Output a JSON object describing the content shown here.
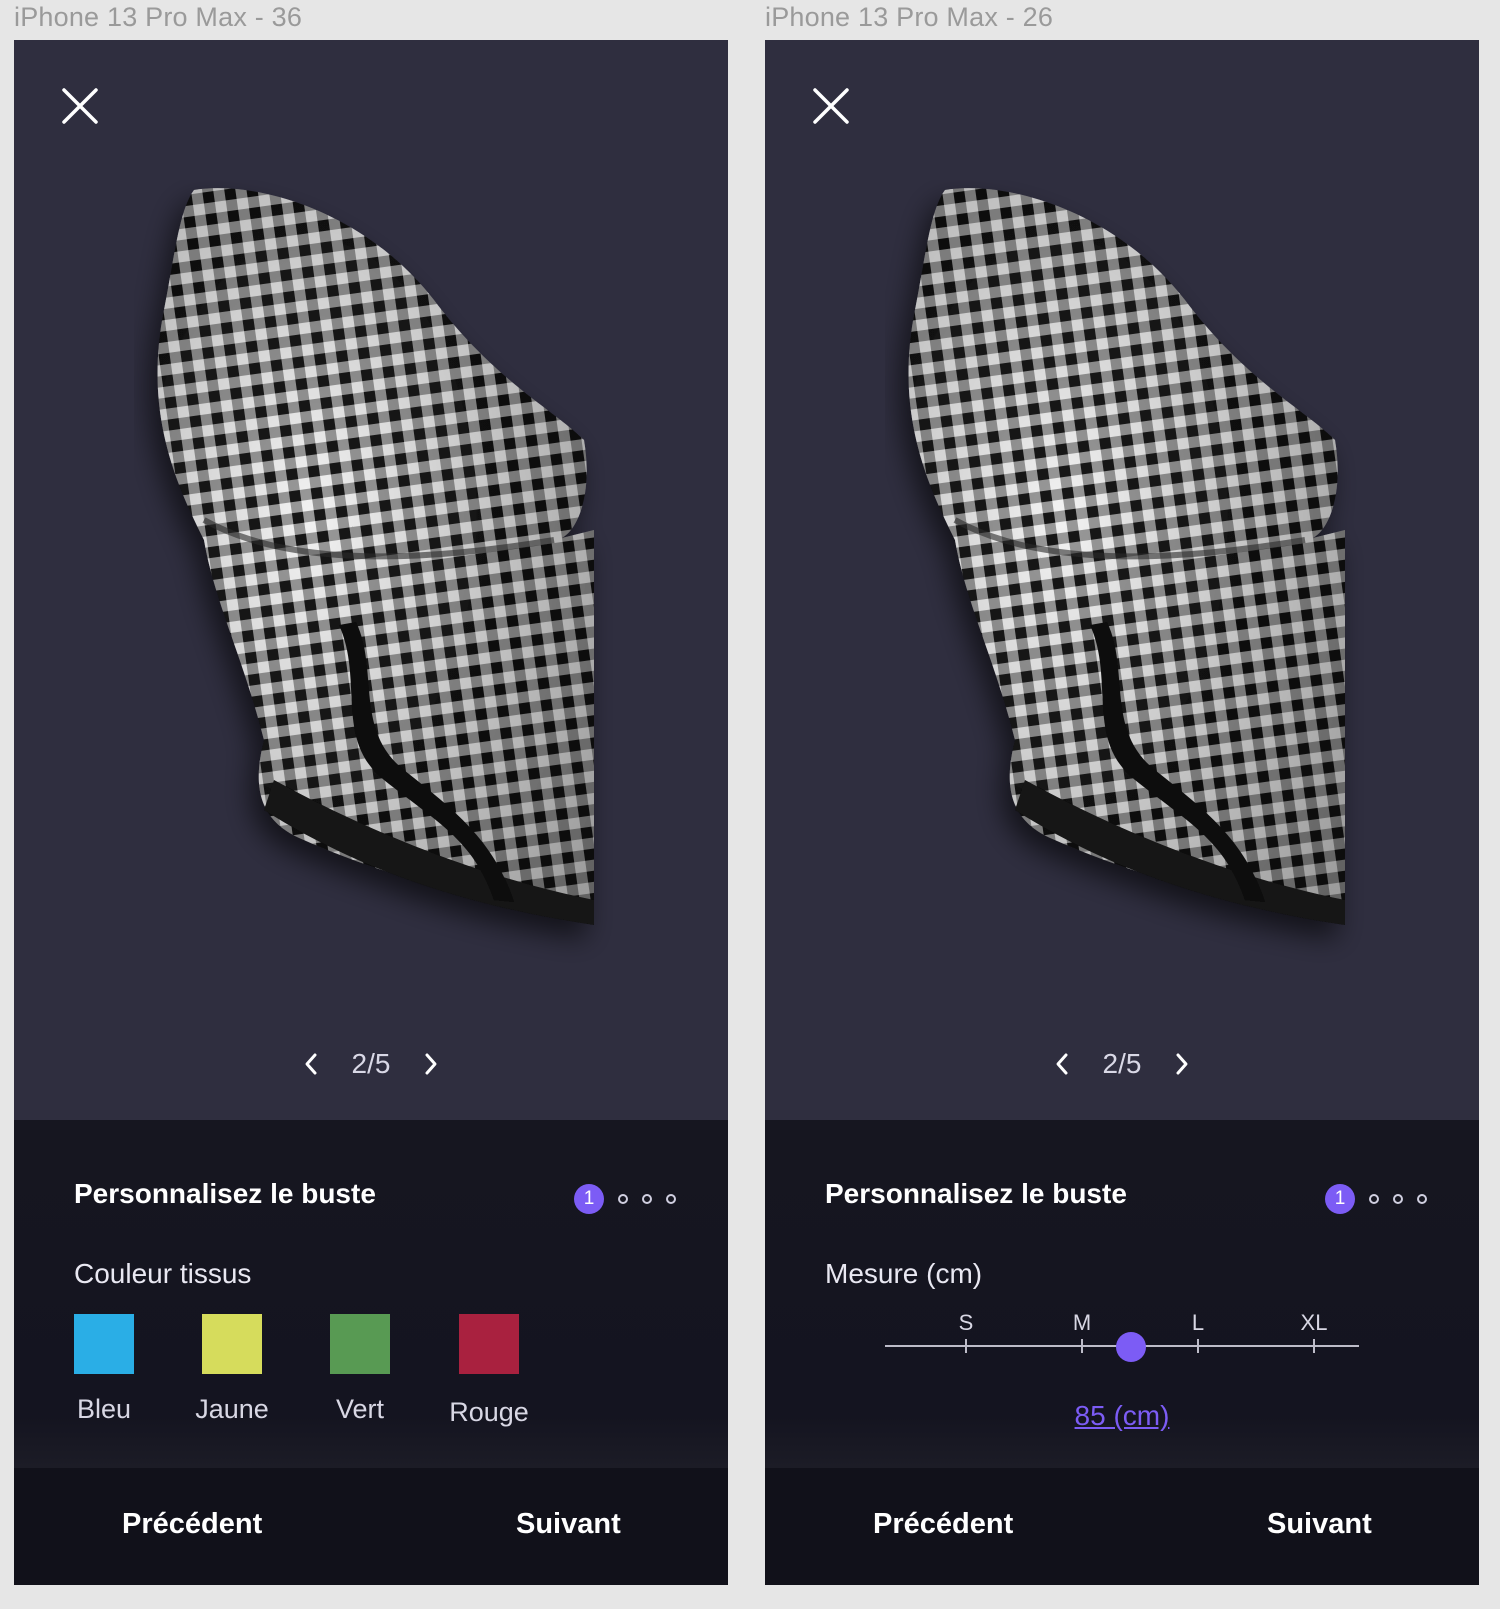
{
  "frames": [
    {
      "title": "iPhone 13 Pro Max - 36",
      "pager": {
        "current": "2/5"
      },
      "panel": {
        "title": "Personnalisez le buste",
        "step_active": "1",
        "section_label": "Couleur tissus",
        "swatches": [
          {
            "label": "Bleu",
            "color": "#2aaee6"
          },
          {
            "label": "Jaune",
            "color": "#d6dc5c"
          },
          {
            "label": "Vert",
            "color": "#589a53"
          },
          {
            "label": "Rouge",
            "color": "#a9213f"
          }
        ]
      },
      "footer": {
        "prev": "Précédent",
        "next": "Suivant"
      }
    },
    {
      "title": "iPhone 13 Pro Max - 26",
      "pager": {
        "current": "2/5"
      },
      "panel": {
        "title": "Personnalisez le buste",
        "step_active": "1",
        "section_label": "Mesure (cm)",
        "slider": {
          "sizes": [
            "S",
            "M",
            "L",
            "XL"
          ],
          "value_label": "85 (cm)",
          "position_fraction": 0.52
        }
      },
      "footer": {
        "prev": "Précédent",
        "next": "Suivant"
      }
    }
  ],
  "colors": {
    "phone_bg": "#2f2e3f",
    "panel_bg": "#161620",
    "accent": "#7c5cf5"
  }
}
